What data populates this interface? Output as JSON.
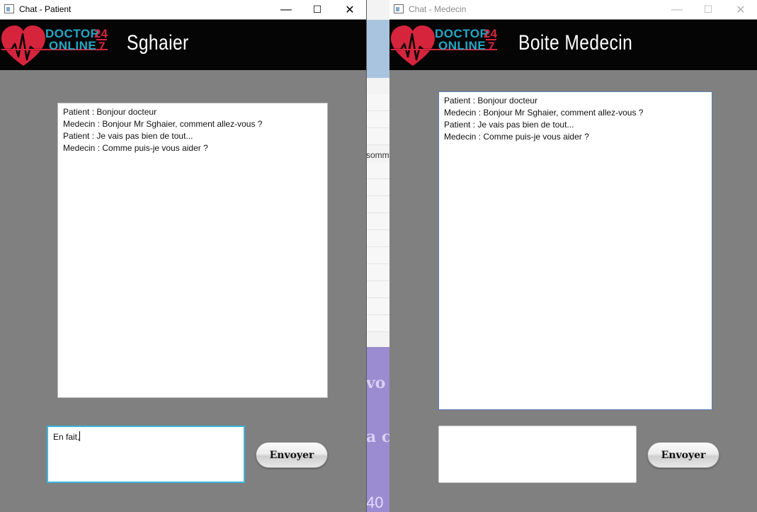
{
  "background_app": {
    "fragment_text": "somme",
    "purple_fragment_1": "vo",
    "purple_fragment_2": "a c",
    "purple_fragment_3": "40"
  },
  "patient_window": {
    "title": "Chat - Patient",
    "logo": {
      "line1": "DOCTOR",
      "line2": "ONLINE",
      "num1": "24",
      "num2": "7"
    },
    "header_title": "Sghaier",
    "messages": [
      "Patient : Bonjour docteur",
      "Medecin : Bonjour Mr Sghaier, comment allez-vous ?",
      "Patient : Je vais pas bien de tout...",
      "Medecin : Comme puis-je vous aider ?"
    ],
    "input_value": "En fait,",
    "send_label": "Envoyer"
  },
  "medecin_window": {
    "title": "Chat - Medecin",
    "logo": {
      "line1": "DOCTOR",
      "line2": "ONLINE",
      "num1": "24",
      "num2": "7"
    },
    "header_title": "Boite Medecin",
    "messages": [
      "Patient : Bonjour docteur",
      "Medecin : Bonjour Mr Sghaier, comment allez-vous ?",
      "Patient : Je vais pas bien de tout...",
      "Medecin : Comme puis-je vous aider ?"
    ],
    "input_value": "",
    "send_label": "Envoyer"
  },
  "window_controls": {
    "minimize": "—",
    "maximize": "☐",
    "close": "✕"
  },
  "colors": {
    "accent_cyan": "#22a9c6",
    "accent_red": "#d6243d",
    "window_bg": "#808080",
    "header_bg": "#050505"
  },
  "icons": {
    "logo": "heart-pulse-icon",
    "app": "window-app-icon"
  }
}
